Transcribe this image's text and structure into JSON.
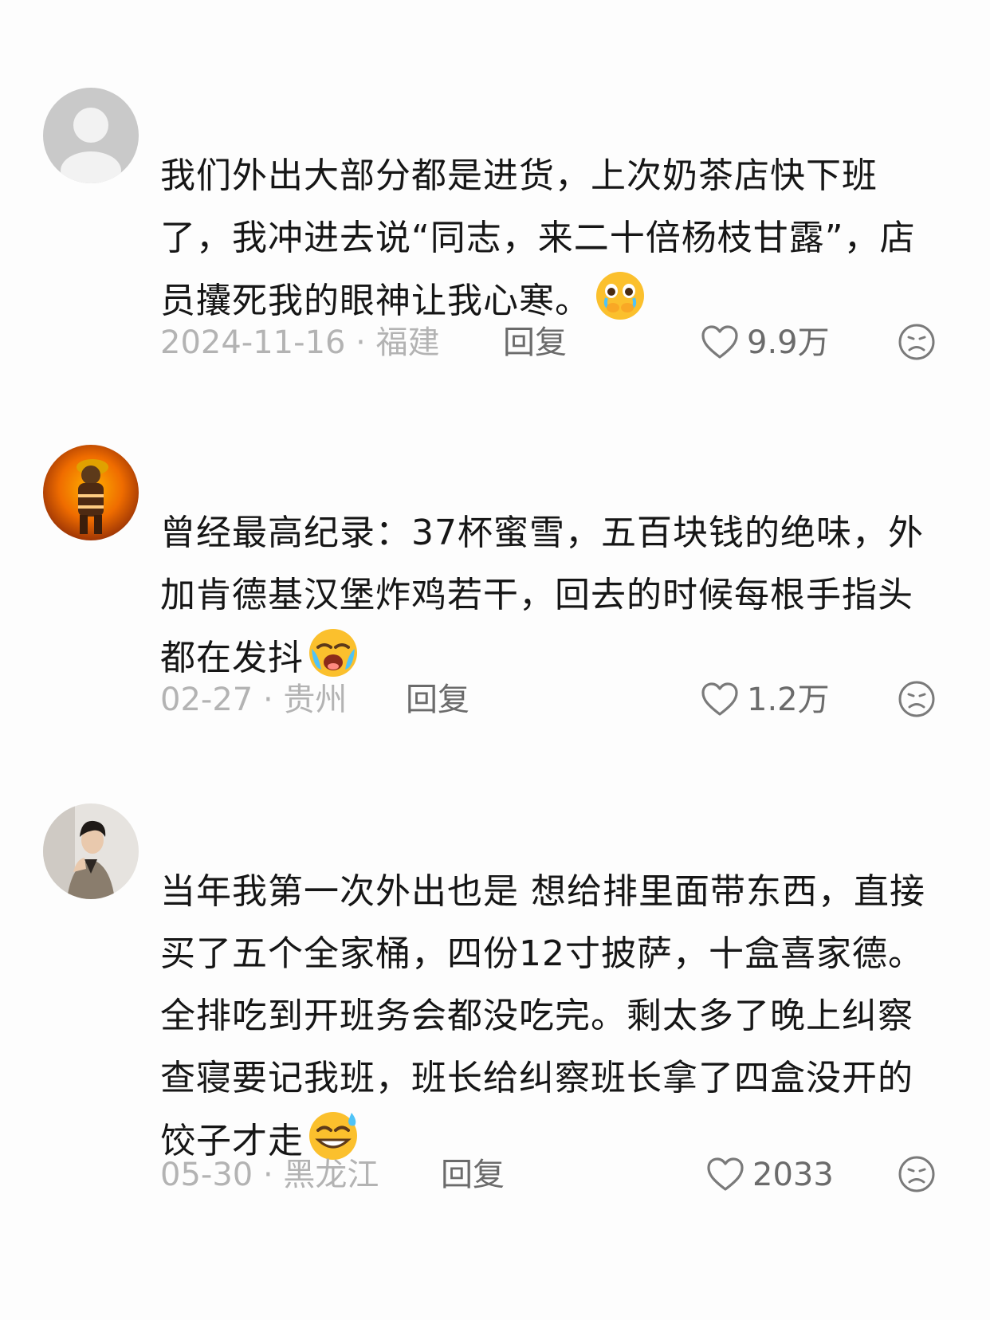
{
  "comments": [
    {
      "avatar": "default-person-avatar",
      "text": "我们外出大部分都是进货，上次奶茶店快下班了，我冲进去说“同志，来二十倍杨枝甘露”，店员攮死我的眼神让我心寒。",
      "emoji": "pleading-crying-face-emoji",
      "date_location": "2024-11-16 · 福建",
      "reply_label": "回复",
      "like_count": "9.9万"
    },
    {
      "avatar": "firefighter-avatar",
      "text": "曾经最高纪录：37杯蜜雪，五百块钱的绝味，外加肯德基汉堡炸鸡若干，回去的时候每根手指头都在发抖",
      "emoji": "loudly-crying-face-emoji",
      "date_location": "02-27 · 贵州",
      "reply_label": "回复",
      "like_count": "1.2万"
    },
    {
      "avatar": "portrait-man-avatar",
      "text": "当年我第一次外出也是 想给排里面带东西，直接买了五个全家桶，四份12寸披萨，十盒喜家德。全排吃到开班务会都没吃完。剩太多了晚上纠察查寝要记我班，班长给纠察班长拿了四盒没开的饺子才走",
      "emoji": "grinning-sweat-face-emoji",
      "date_location": "05-30 · 黑龙江",
      "reply_label": "回复",
      "like_count": "2033"
    }
  ],
  "colors": {
    "background": "#fdfdfd",
    "text": "#161616",
    "meta_gray": "#b3b3b3",
    "action_gray": "#6b6b6b"
  },
  "icons": {
    "like": "heart-outline-icon",
    "dislike": "sad-face-outline-icon"
  }
}
